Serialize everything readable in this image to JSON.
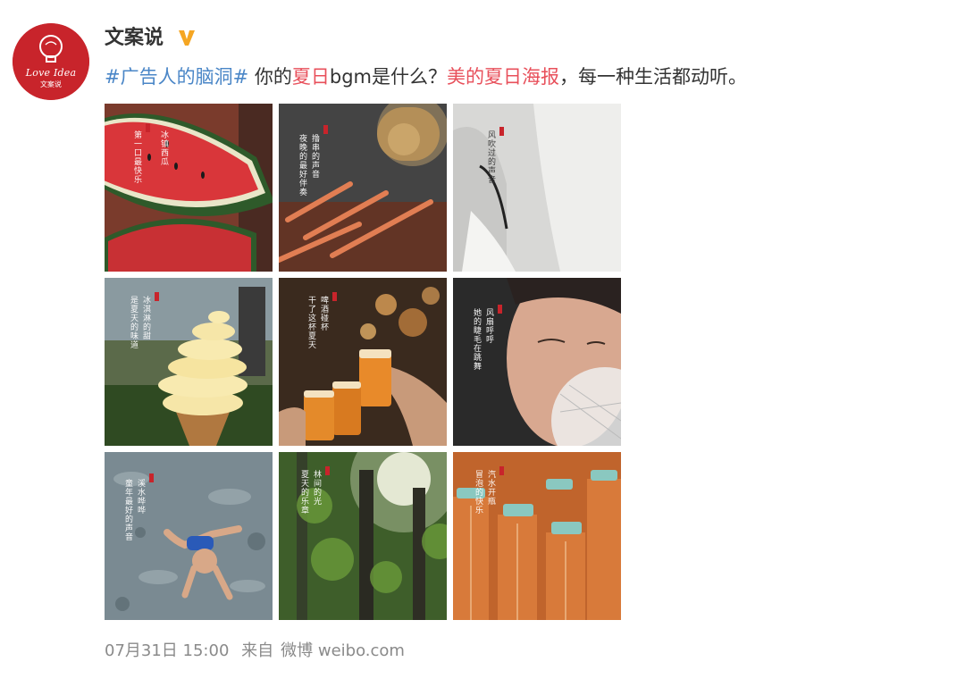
{
  "account": {
    "name": "文案说",
    "avatar_logo": "Love Idea",
    "avatar_sub": "文案说",
    "verified_icon": "verified-v-icon"
  },
  "post": {
    "hashtag": "#广告人的脑洞#",
    "text_1": " 你的",
    "highlight_1": "夏日",
    "text_2": "bgm是什么？",
    "highlight_2": "美的夏日海报",
    "text_3": "，每一种生活都动听。"
  },
  "posters": [
    {
      "subject": "watermelon",
      "caption_a": "冰镇西瓜",
      "caption_b": "第一口最快乐"
    },
    {
      "subject": "street-barbecue",
      "caption_a": "撸串的声音",
      "caption_b": "夜晚的最好伴奏"
    },
    {
      "subject": "wind-curtain",
      "caption_a": "风吹过的声音",
      "caption_b": ""
    },
    {
      "subject": "ice-cream",
      "caption_a": "冰淇淋的甜",
      "caption_b": "是夏天的味道"
    },
    {
      "subject": "beer-toast",
      "caption_a": "啤酒碰杯",
      "caption_b": "干了这杯夏天"
    },
    {
      "subject": "fan-breeze",
      "caption_a": "风扇呼呼",
      "caption_b": "她的睫毛在跳舞"
    },
    {
      "subject": "child-in-stream",
      "caption_a": "溪水哗哗",
      "caption_b": "童年最好的声音"
    },
    {
      "subject": "sunlit-forest",
      "caption_a": "林间的光",
      "caption_b": "夏天的乐章"
    },
    {
      "subject": "soda-bottles",
      "caption_a": "汽水开瓶",
      "caption_b": "冒泡的快乐"
    }
  ],
  "meta": {
    "date": "07月31日 15:00",
    "source_prefix": "来自",
    "source": "微博 weibo.com"
  },
  "colors": {
    "brand_red": "#c8242b",
    "hashtag_blue": "#4a86c7",
    "highlight_red": "#e8505b",
    "verified_gold": "#f5a623",
    "meta_gray": "#8a8a8a"
  }
}
